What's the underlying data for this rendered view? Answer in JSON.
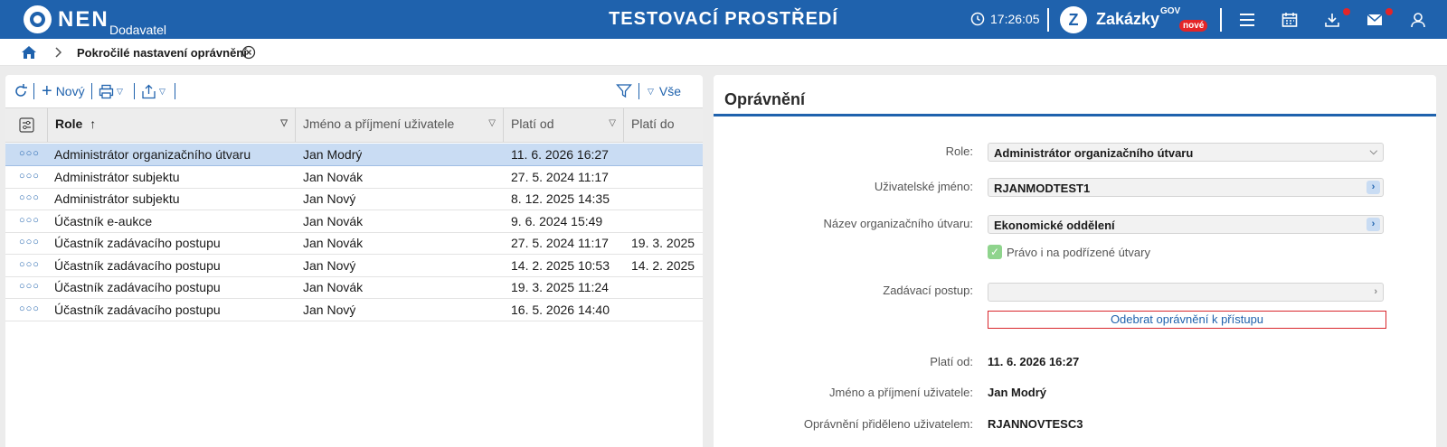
{
  "header": {
    "brand": "NEN",
    "brand_sub": "Dodavatel",
    "environment": "TESTOVACÍ PROSTŘEDÍ",
    "time": "17:26:05",
    "zakazky": "Zakázky",
    "zakazky_sup": "GOV",
    "zakazky_badge": "nové",
    "icons": [
      "clock-icon",
      "menu-icon",
      "calendar-icon",
      "download-icon",
      "mail-icon",
      "user-icon"
    ]
  },
  "breadcrumb": {
    "page": "Pokročilé nastavení oprávnění"
  },
  "toolbar": {
    "new_label": "Nový",
    "filter_label": "Vše"
  },
  "grid": {
    "columns": [
      "Role",
      "Jméno a příjmení uživatele",
      "Platí od",
      "Platí do"
    ],
    "rows": [
      {
        "role": "Administrátor organizačního útvaru",
        "name": "Jan Modrý",
        "from": "11. 6. 2026 16:27",
        "to": "",
        "selected": true
      },
      {
        "role": "Administrátor subjektu",
        "name": "Jan Novák",
        "from": "27. 5. 2024 11:17",
        "to": ""
      },
      {
        "role": "Administrátor subjektu",
        "name": "Jan Nový",
        "from": "8. 12. 2025 14:35",
        "to": ""
      },
      {
        "role": "Účastník e-aukce",
        "name": "Jan Novák",
        "from": "9. 6. 2024 15:49",
        "to": ""
      },
      {
        "role": "Účastník zadávacího postupu",
        "name": "Jan Novák",
        "from": "27. 5. 2024 11:17",
        "to": "19. 3. 2025"
      },
      {
        "role": "Účastník zadávacího postupu",
        "name": "Jan Nový",
        "from": "14. 2. 2025 10:53",
        "to": "14. 2. 2025"
      },
      {
        "role": "Účastník zadávacího postupu",
        "name": "Jan Novák",
        "from": "19. 3. 2025 11:24",
        "to": ""
      },
      {
        "role": "Účastník zadávacího postupu",
        "name": "Jan Nový",
        "from": "16. 5. 2026 14:40",
        "to": ""
      }
    ]
  },
  "detail": {
    "title": "Oprávnění",
    "role_label": "Role:",
    "role_value": "Administrátor organizačního útvaru",
    "username_label": "Uživatelské jméno:",
    "username_value": "RJANMODTEST1",
    "unit_label": "Název organizačního útvaru:",
    "unit_value": "Ekonomické oddělení",
    "subunits_label": "Právo i na podřízené útvary",
    "procedure_label": "Zadávací postup:",
    "procedure_value": "",
    "revoke_label": "Odebrat oprávnění k přístupu",
    "valid_from_label": "Platí od:",
    "valid_from_value": "11. 6. 2026 16:27",
    "fullname_label": "Jméno a příjmení uživatele:",
    "fullname_value": "Jan Modrý",
    "assigned_label": "Oprávnění přiděleno uživatelem:",
    "assigned_value": "RJANNOVTESC3"
  },
  "colors": {
    "primary": "#1f62ad",
    "selected_row": "#c9dcf3",
    "badge_red": "#e42528",
    "check_green": "#8fd48d"
  }
}
